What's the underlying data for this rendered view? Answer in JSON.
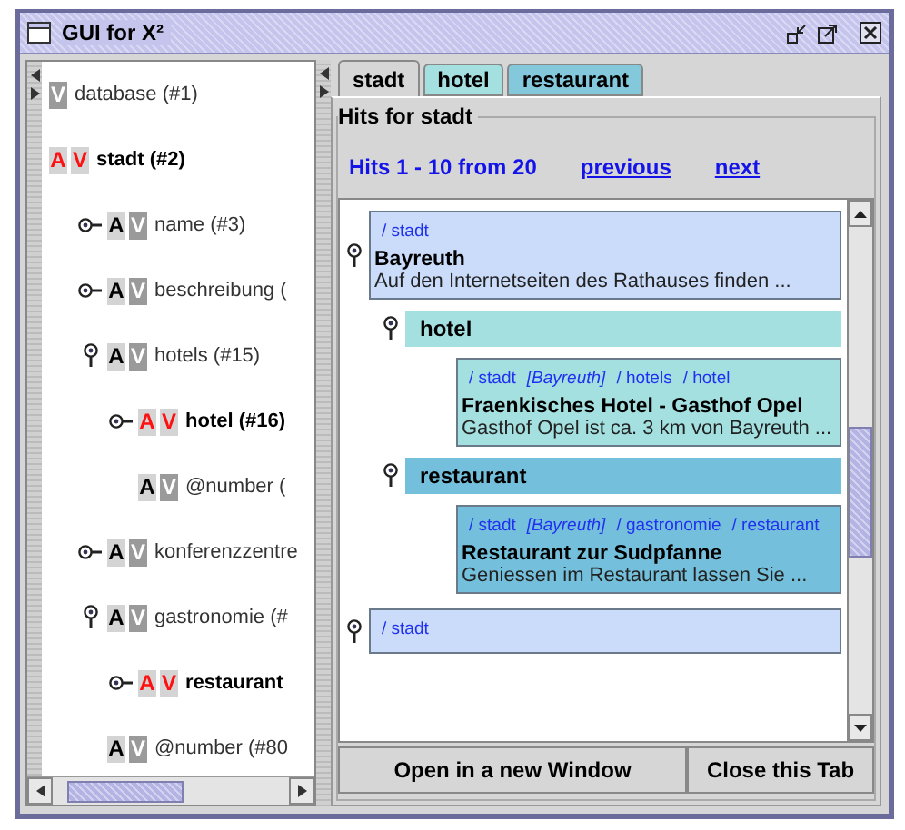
{
  "window": {
    "title": "GUI for X²"
  },
  "tree": [
    {
      "v": "V",
      "label": "database (#1)",
      "marked": false
    },
    {
      "a": "A",
      "v": "V",
      "label": "stadt (#2)",
      "marked": true,
      "children": [
        {
          "a": "A",
          "v": "V",
          "label": "name (#3)",
          "marked": false,
          "kind": "leaf"
        },
        {
          "a": "A",
          "v": "V",
          "label": "beschreibung (",
          "marked": false,
          "kind": "leaf"
        },
        {
          "a": "A",
          "v": "V",
          "label": "hotels (#15)",
          "marked": false,
          "kind": "branch",
          "children": [
            {
              "a": "A",
              "v": "V",
              "label": "hotel (#16)",
              "marked": true,
              "kind": "leaf"
            },
            {
              "a": "A",
              "v": "V",
              "label": "@number (",
              "marked": false,
              "kind": "plain"
            }
          ]
        },
        {
          "a": "A",
          "v": "V",
          "label": "konferenzzentre",
          "marked": false,
          "kind": "leaf"
        },
        {
          "a": "A",
          "v": "V",
          "label": "gastronomie (#",
          "marked": false,
          "kind": "branch",
          "children": [
            {
              "a": "A",
              "v": "V",
              "label": "restaurant",
              "marked": true,
              "kind": "leaf"
            }
          ]
        },
        {
          "a": "A",
          "v": "V",
          "label": "@number (#80",
          "marked": false,
          "kind": "plain"
        }
      ]
    }
  ],
  "tabs": [
    {
      "label": "stadt",
      "selected": true,
      "color": "#d6d6d6"
    },
    {
      "label": "hotel",
      "selected": false,
      "color": "#a4e0e0"
    },
    {
      "label": "restaurant",
      "selected": false,
      "color": "#84c8dc"
    }
  ],
  "group_title": "Hits for stadt",
  "hits": "Hits 1 - 10 from 20",
  "links": [
    "previous",
    "next"
  ],
  "results": [
    {
      "color": "#cadcfa",
      "path": [
        {
          "kind": "path",
          "text": "/ stadt"
        }
      ],
      "title": "Bayreuth",
      "text": "Auf den Internetseiten des Rathauses finden ...",
      "sections": [
        {
          "label": "hotel",
          "color": "#a4e0e0",
          "cards": [
            {
              "path": [
                {
                  "kind": "path",
                  "text": "/ stadt"
                },
                {
                  "kind": "ref",
                  "text": "[Bayreuth]"
                },
                {
                  "kind": "path",
                  "text": "/ hotels"
                },
                {
                  "kind": "path",
                  "text": "/ hotel"
                }
              ],
              "title": "Fraenkisches Hotel - Gasthof Opel",
              "text": "Gasthof Opel ist ca. 3 km von Bayreuth ..."
            }
          ]
        },
        {
          "label": "restaurant",
          "color": "#74c0dc",
          "cards": [
            {
              "path": [
                {
                  "kind": "path",
                  "text": "/ stadt"
                },
                {
                  "kind": "ref",
                  "text": "[Bayreuth]"
                },
                {
                  "kind": "path",
                  "text": "/ gastronomie"
                },
                {
                  "kind": "path",
                  "text": "/ restaurant"
                }
              ],
              "title": "Restaurant zur Sudpfanne",
              "text": "Geniessen im Restaurant lassen Sie ..."
            }
          ]
        }
      ]
    },
    {
      "color": "#cadcfa",
      "path": [
        {
          "kind": "path",
          "text": "/ stadt"
        }
      ]
    }
  ],
  "buttons": [
    "Open in a new Window",
    "Close this Tab"
  ]
}
